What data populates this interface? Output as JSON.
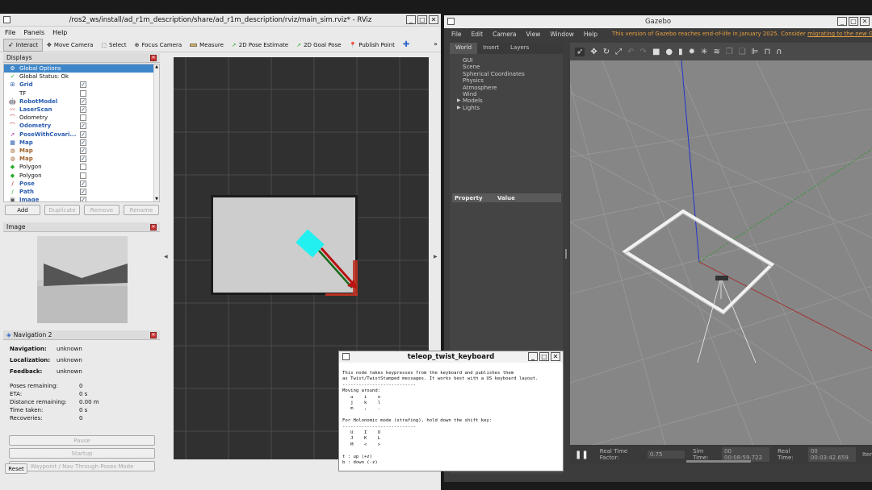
{
  "rviz": {
    "title": "/ros2_ws/install/ad_r1m_description/share/ad_r1m_description/rviz/main_sim.rviz* - RViz",
    "menu": [
      "File",
      "Panels",
      "Help"
    ],
    "tools": [
      {
        "icon": "interact-icon",
        "label": "Interact"
      },
      {
        "icon": "move-camera-icon",
        "label": "Move Camera"
      },
      {
        "icon": "select-icon",
        "label": "Select"
      },
      {
        "icon": "focus-camera-icon",
        "label": "Focus Camera"
      },
      {
        "icon": "measure-icon",
        "label": "Measure"
      },
      {
        "icon": "pose-estimate-icon",
        "label": "2D Pose Estimate"
      },
      {
        "icon": "goal-pose-icon",
        "label": "2D Goal Pose"
      },
      {
        "icon": "publish-point-icon",
        "label": "Publish Point"
      }
    ],
    "displays": {
      "header": "Displays",
      "items": [
        {
          "label": "Global Options",
          "style": "sel",
          "checked": ""
        },
        {
          "label": "Global Status: Ok",
          "style": "",
          "checked": ""
        },
        {
          "label": "Grid",
          "style": "blue",
          "checked": "✓"
        },
        {
          "label": "TF",
          "style": "",
          "checked": " "
        },
        {
          "label": "RobotModel",
          "style": "blue",
          "checked": "✓"
        },
        {
          "label": "LaserScan",
          "style": "blue",
          "checked": "✓"
        },
        {
          "label": "Odometry",
          "style": "",
          "checked": " "
        },
        {
          "label": "Odometry",
          "style": "blue",
          "checked": "✓"
        },
        {
          "label": "PoseWithCovari...",
          "style": "blue",
          "checked": "✓"
        },
        {
          "label": "Map",
          "style": "blue",
          "checked": "✓"
        },
        {
          "label": "Map",
          "style": "brown",
          "checked": "✓"
        },
        {
          "label": "Map",
          "style": "brown",
          "checked": "✓"
        },
        {
          "label": "Polygon",
          "style": "",
          "checked": " "
        },
        {
          "label": "Polygon",
          "style": "",
          "checked": " "
        },
        {
          "label": "Pose",
          "style": "blue",
          "checked": "✓"
        },
        {
          "label": "Path",
          "style": "blue",
          "checked": "✓"
        },
        {
          "label": "Image",
          "style": "blue",
          "checked": "✓"
        }
      ],
      "buttons": {
        "add": "Add",
        "duplicate": "Duplicate",
        "remove": "Remove",
        "rename": "Rename"
      }
    },
    "image_panel": {
      "header": "Image"
    },
    "nav2": {
      "header": "Navigation 2",
      "navigation_label": "Navigation:",
      "navigation_value": "unknown",
      "localization_label": "Localization:",
      "localization_value": "unknown",
      "feedback_label": "Feedback:",
      "feedback_value": "unknown",
      "poses_remaining_label": "Poses remaining:",
      "poses_remaining_value": "0",
      "eta_label": "ETA:",
      "eta_value": "0 s",
      "distance_label": "Distance remaining:",
      "distance_value": "0.00 m",
      "time_taken_label": "Time taken:",
      "time_taken_value": "0 s",
      "recoveries_label": "Recoveries:",
      "recoveries_value": "0",
      "pause_button": "Pause",
      "startup_button": "Startup",
      "waypoint_button": "Waypoint / Nav Through Poses Mode"
    },
    "reset_button": "Reset"
  },
  "gazebo": {
    "title": "Gazebo",
    "menu": [
      "File",
      "Edit",
      "Camera",
      "View",
      "Window",
      "Help"
    ],
    "eol_notice": "This version of Gazebo reaches end-of-life in January 2025. Consider",
    "eol_link": "migrating to the new Gazebo",
    "tabs": [
      "World",
      "Insert",
      "Layers"
    ],
    "tree": [
      "GUI",
      "Scene",
      "Spherical Coordinates",
      "Physics",
      "Atmosphere",
      "Wind",
      "Models",
      "Lights"
    ],
    "property_col": "Property",
    "value_col": "Value",
    "status": {
      "rtf_label": "Real Time Factor:",
      "rtf_value": "0.75",
      "sim_time_label": "Sim Time:",
      "sim_time_value": "00 00:08:59.722",
      "real_time_label": "Real Time:",
      "real_time_value": "00 00:03:42.659",
      "iter_label": "Iter"
    }
  },
  "teleop": {
    "title": "teleop_twist_keyboard",
    "lines": [
      "This node takes keypresses from the keyboard and publishes them",
      "as Twist/TwistStamped messages. It works best with a US keyboard layout.",
      "---------------------------",
      "Moving around:",
      "   u    i    o",
      "   j    k    l",
      "   m    ,    .",
      "",
      "For Holonomic mode (strafing), hold down the shift key:",
      "---------------------------",
      "   U    I    O",
      "   J    K    L",
      "   M    <    >",
      "",
      "t : up (+z)",
      "b : down (-z)"
    ]
  }
}
